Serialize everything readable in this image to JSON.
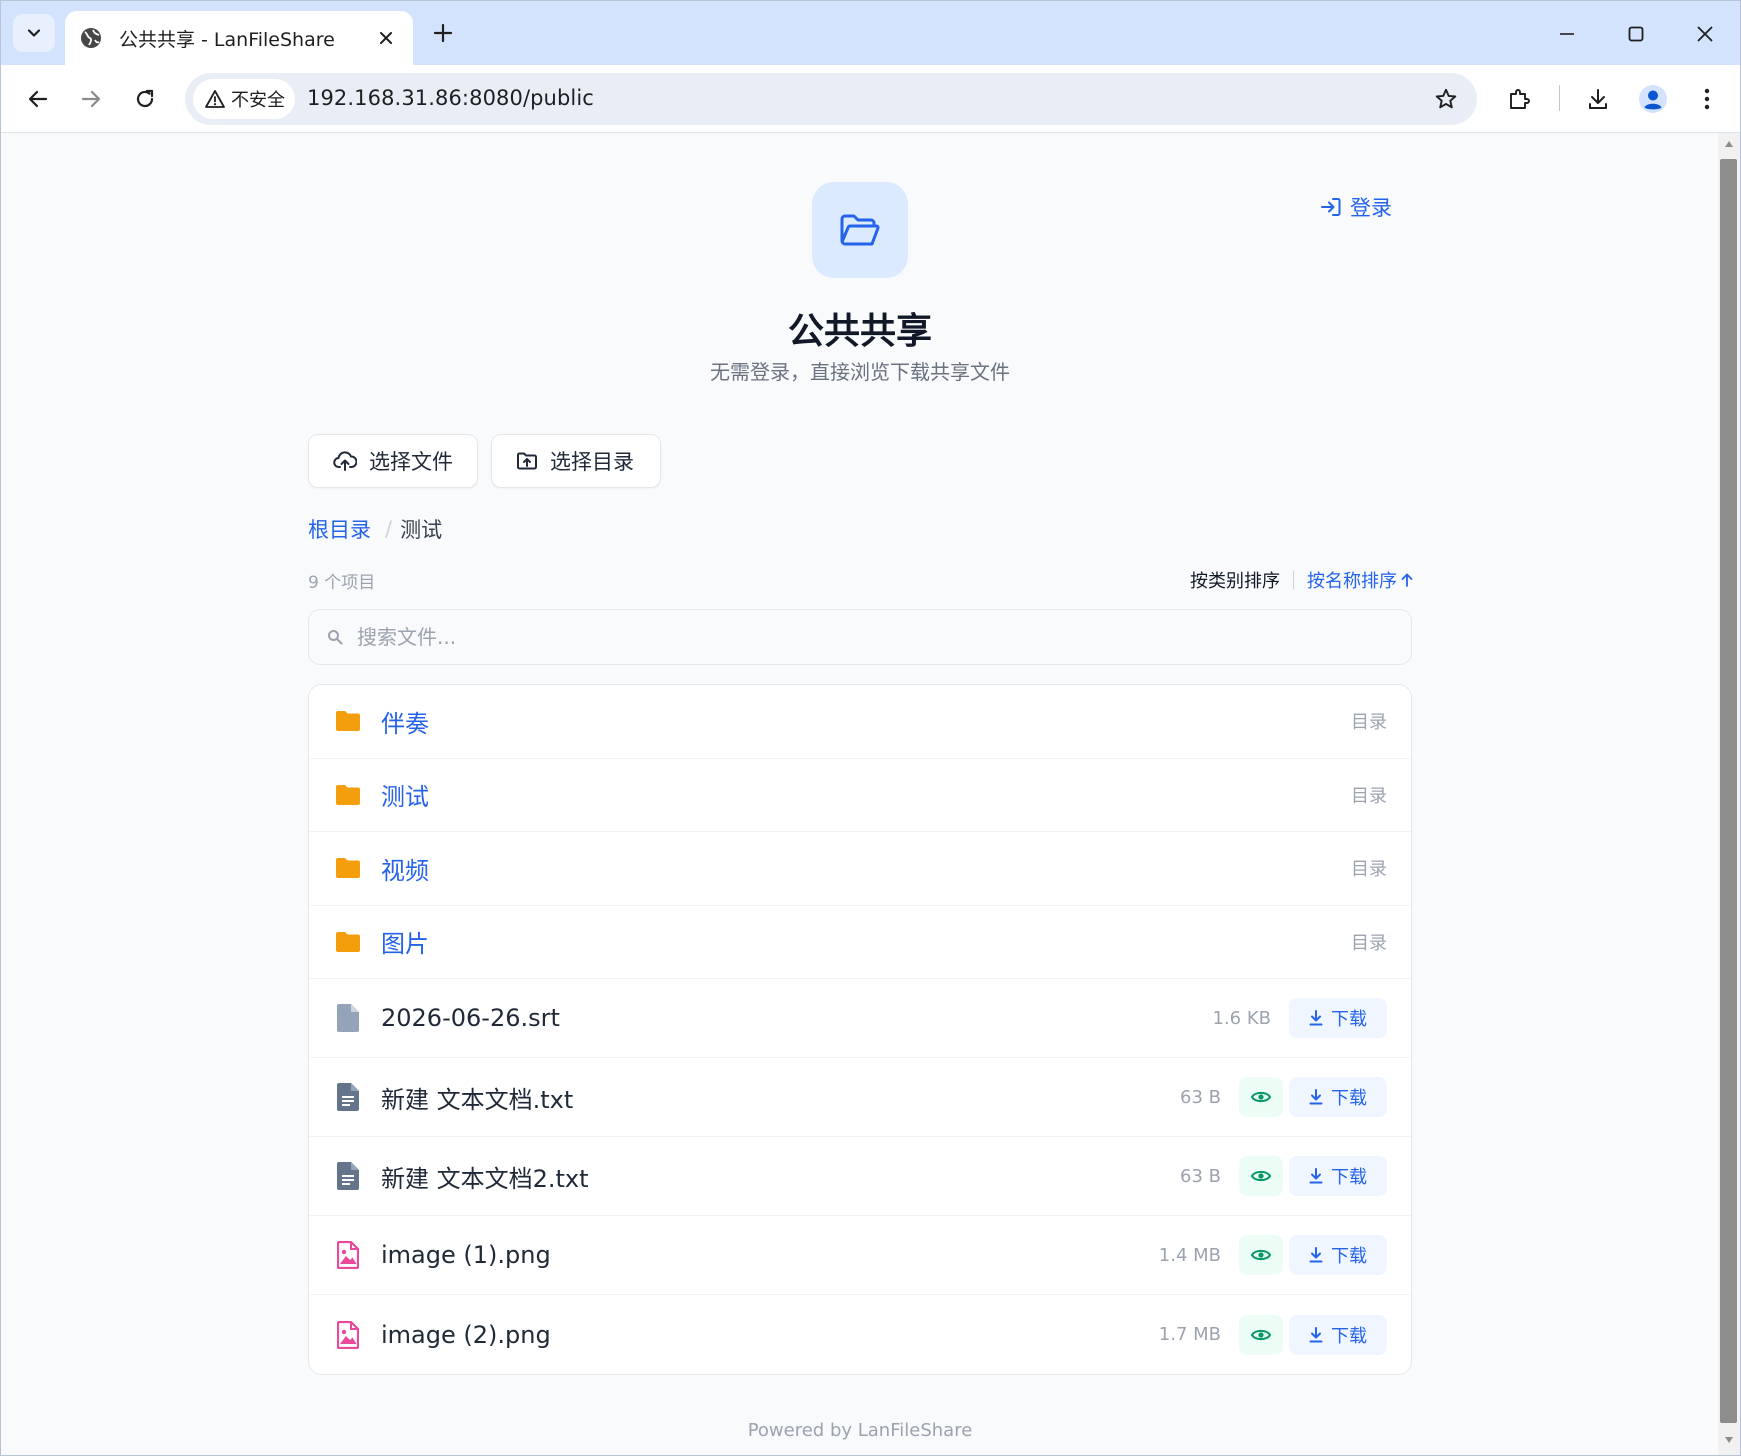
{
  "browser": {
    "tab_title": "公共共享 - LanFileShare",
    "security_label": "不安全",
    "url": "192.168.31.86:8080/public"
  },
  "header": {
    "login_label": "登录",
    "title": "公共共享",
    "subtitle": "无需登录，直接浏览下载共享文件"
  },
  "actions": {
    "select_file_label": "选择文件",
    "select_dir_label": "选择目录"
  },
  "breadcrumb": {
    "root_label": "根目录",
    "separator": "/",
    "current_label": "测试"
  },
  "listing": {
    "item_count": "9 个项目",
    "sort_by_category": "按类别排序",
    "sort_by_name": "按名称排序",
    "search_placeholder": "搜索文件..."
  },
  "directories": [
    {
      "name": "伴奏",
      "type": "目录"
    },
    {
      "name": "测试",
      "type": "目录"
    },
    {
      "name": "视频",
      "type": "目录"
    },
    {
      "name": "图片",
      "type": "目录"
    }
  ],
  "files": [
    {
      "name": "2026-06-26.srt",
      "size": "1.6 KB",
      "icon": "generic-file-icon",
      "previewable": false,
      "download_label": "下载"
    },
    {
      "name": "新建 文本文档.txt",
      "size": "63 B",
      "icon": "text-file-icon",
      "previewable": true,
      "download_label": "下载"
    },
    {
      "name": "新建 文本文档2.txt",
      "size": "63 B",
      "icon": "text-file-icon",
      "previewable": true,
      "download_label": "下载"
    },
    {
      "name": "image (1).png",
      "size": "1.4 MB",
      "icon": "image-file-icon",
      "previewable": true,
      "download_label": "下载"
    },
    {
      "name": "image (2).png",
      "size": "1.7 MB",
      "icon": "image-file-icon",
      "previewable": true,
      "download_label": "下载"
    }
  ],
  "footer": {
    "text": "Powered by LanFileShare"
  },
  "colors": {
    "accent": "#2563eb",
    "folder": "#f59e0b",
    "image_file": "#ec4899",
    "text_file": "#64748b",
    "generic_file": "#94a3b8",
    "preview": "#059669"
  }
}
